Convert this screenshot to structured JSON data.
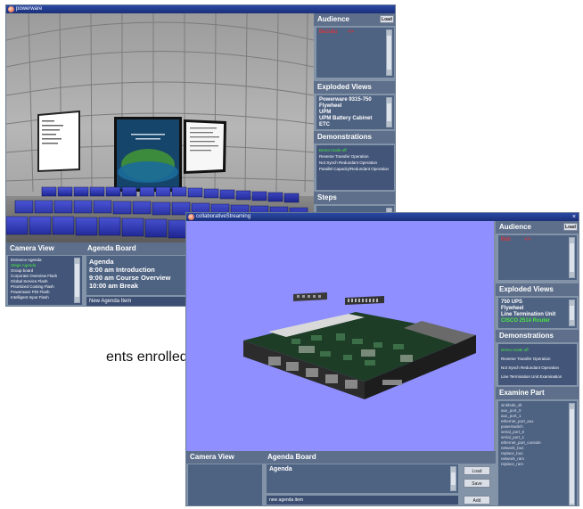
{
  "w1": {
    "title": "powerware",
    "audience": {
      "title": "Audience",
      "btn": "Load",
      "member": "Bezobu",
      "member_status": "<>"
    },
    "exploded": {
      "title": "Exploded Views",
      "items": [
        "Powerware 9315-750",
        "Flywheel",
        "UPM",
        "UPM Battery Cabinet",
        "ETC"
      ]
    },
    "demos": {
      "title": "Demonstrations",
      "items": [
        "Demo mode off",
        "Reverse Transfer Operation",
        "Not Synch Redundant Operation",
        "Parallel Capacity/Redundant Operation"
      ]
    },
    "steps": {
      "title": "Steps"
    },
    "camera": {
      "title": "Camera View",
      "items": [
        "Entrance Agenda",
        "Stage Agenda",
        "Group board",
        "Corporate Overview Flash",
        "Global Service Flash",
        "Prioritized Costing Flash",
        "Powerware PDI Flash",
        "Intelligent Input Flash"
      ]
    },
    "agenda": {
      "title": "Agenda Board",
      "heading": "Agenda",
      "items": [
        "8:00 am Introduction",
        "9:00 am Course Overview",
        "10:00 am Break"
      ],
      "new_item": "New Agenda Item"
    }
  },
  "w2": {
    "title": "collaborativeStreaming",
    "audience": {
      "title": "Audience",
      "btn": "Load",
      "member": "Bob",
      "member_status": "<>"
    },
    "exploded": {
      "title": "Exploded Views",
      "items": [
        "750 UPS",
        "Flywheel",
        "Line Termination Unit",
        "CISCO 2514 Router"
      ]
    },
    "demos": {
      "title": "Demonstrations",
      "items": [
        "Demo mode off",
        "Reverse Transfer Operation",
        "Not Synch Redundant Operation",
        "Line Termination Unit Examination"
      ]
    },
    "examine": {
      "title": "Examine Part",
      "items": [
        "sinkhole_slt",
        "aux_port_0",
        "aux_port_1",
        "ethernet_port_aux",
        "powerswitch",
        "serial_port_0",
        "serial_port_1",
        "ethernet_port_console",
        "network_bus",
        "replace_bus",
        "network_ram",
        "replace_ram"
      ]
    },
    "camera": {
      "title": "Camera View"
    },
    "agenda": {
      "title": "Agenda Board",
      "heading": "Agenda",
      "new_item": "new agenda item",
      "buttons": [
        "Load",
        "Save",
        "Add"
      ]
    }
  },
  "caption": "ents enrolled in"
}
